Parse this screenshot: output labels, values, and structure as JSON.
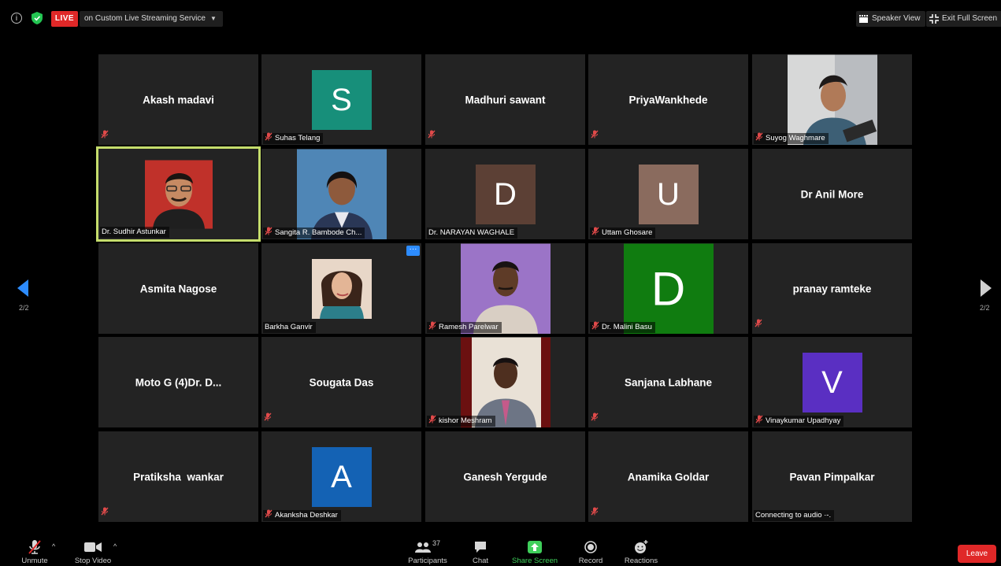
{
  "topbar": {
    "live_badge": "LIVE",
    "stream_label": "on Custom Live Streaming Service",
    "speaker_view": "Speaker View",
    "exit_full_screen": "Exit Full Screen"
  },
  "pagination": {
    "left": "2/2",
    "right": "2/2"
  },
  "participants": [
    {
      "display_name": "Akash madavi",
      "label": "",
      "muted": true
    },
    {
      "letter": "S",
      "color": "#178f7a",
      "label": "Suhas Telang",
      "muted": true
    },
    {
      "display_name": "Madhuri sawant",
      "label": "",
      "muted": true
    },
    {
      "display_name": "PriyaWankhede",
      "label": "",
      "muted": true
    },
    {
      "photo": "young man photo",
      "label": "Suyog Waghmare",
      "muted": true
    },
    {
      "photo": "man with glasses photo",
      "label": "Dr. Sudhir Astunkar",
      "muted": false,
      "active": true
    },
    {
      "photo": "woman in blazer photo",
      "label": "Sangita R. Bambode Ch...",
      "muted": true
    },
    {
      "letter": "D",
      "color": "#5c4035",
      "label": "Dr. NARAYAN WAGHALE",
      "muted": false
    },
    {
      "letter": "U",
      "color": "#8a6b5e",
      "label": "Uttam Ghosare",
      "muted": true
    },
    {
      "display_name": "Dr Anil More",
      "label": "",
      "muted": false
    },
    {
      "display_name": "Asmita Nagose",
      "label": "",
      "muted": false
    },
    {
      "photo": "woman portrait photo",
      "label": "Barkha Ganvir",
      "muted": false,
      "more": true
    },
    {
      "photo": "man on purple photo",
      "label": "Ramesh Parelwar",
      "muted": true
    },
    {
      "letter": "D",
      "color": "#107c10",
      "label": "Dr. Malini Basu",
      "muted": true,
      "big": true
    },
    {
      "display_name": "pranay ramteke",
      "label": "",
      "muted": true
    },
    {
      "display_name": "Moto G (4)Dr. D...",
      "label": "",
      "muted": false
    },
    {
      "display_name": "Sougata Das",
      "label": "",
      "muted": true
    },
    {
      "photo": "man in suit photo",
      "label": "kishor Meshram",
      "muted": true
    },
    {
      "display_name": "Sanjana Labhane",
      "label": "",
      "muted": true
    },
    {
      "letter": "V",
      "color": "#5a2fc2",
      "label": "Vinaykumar Upadhyay",
      "muted": true
    },
    {
      "display_name": "Pratiksha  wankar",
      "label": "",
      "muted": true
    },
    {
      "letter": "A",
      "color": "#1462b4",
      "label": "Akanksha Deshkar",
      "muted": true
    },
    {
      "display_name": "Ganesh Yergude",
      "label": "",
      "muted": false
    },
    {
      "display_name": "Anamika Goldar",
      "label": "",
      "muted": true
    },
    {
      "display_name": "Pavan Pimpalkar",
      "label": "Connecting to audio ·-.",
      "muted": false
    }
  ],
  "toolbar": {
    "unmute": "Unmute",
    "stop_video": "Stop Video",
    "participants": "Participants",
    "participants_count": "37",
    "chat": "Chat",
    "share_screen": "Share Screen",
    "record": "Record",
    "reactions": "Reactions",
    "leave": "Leave"
  },
  "colors": {
    "live_red": "#e02828",
    "active_border": "#c5dd6c",
    "share_green": "#3fcf5b",
    "tile_bg": "#232323"
  }
}
